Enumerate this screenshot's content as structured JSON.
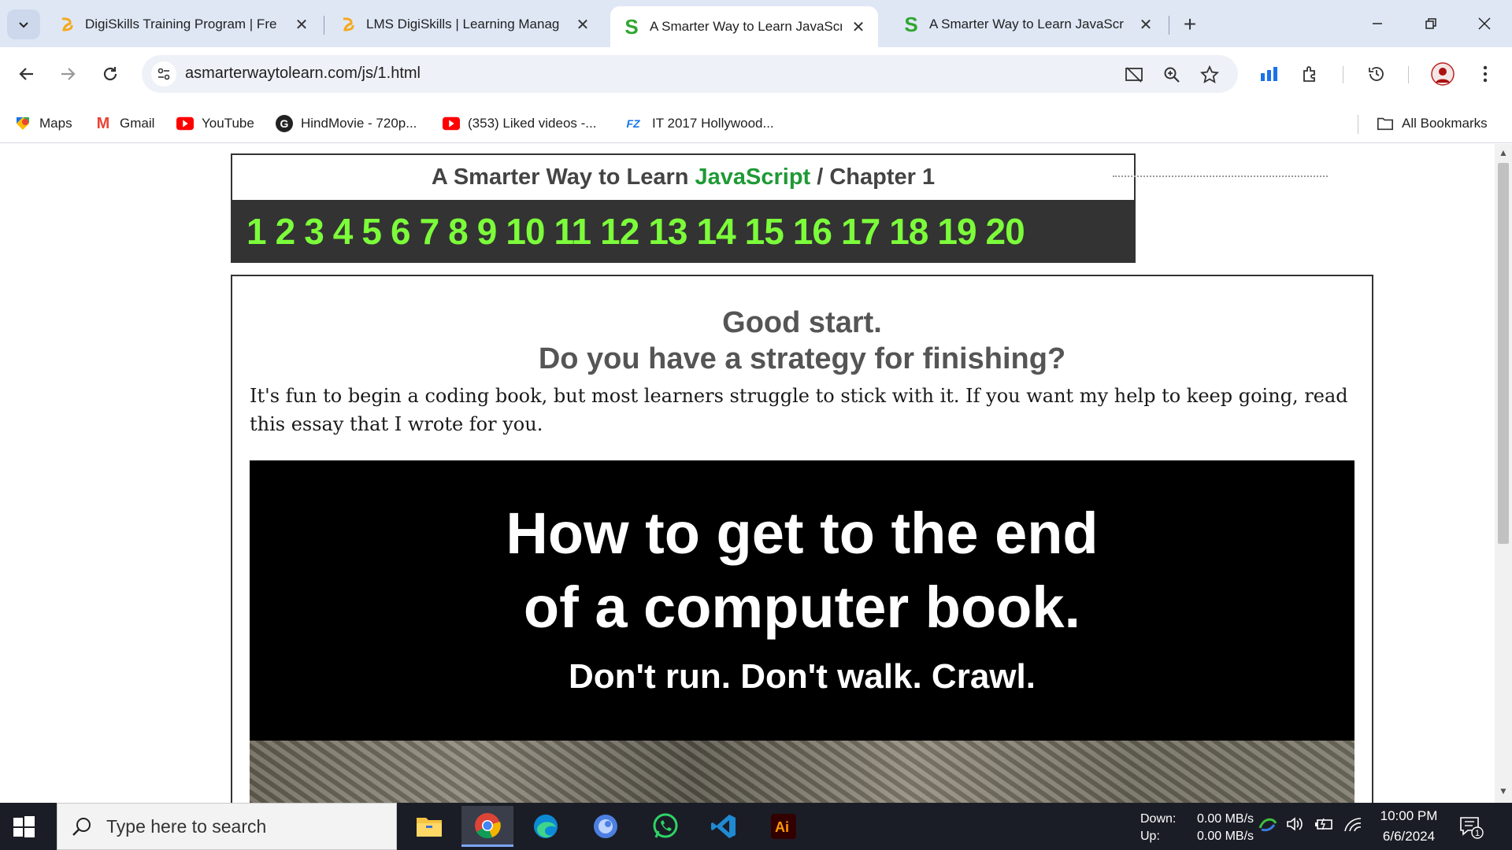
{
  "browser": {
    "tabs": [
      {
        "label": "DigiSkills Training Program | Fre",
        "favicon": "digiskills-icon",
        "active": false
      },
      {
        "label": "LMS DigiSkills | Learning Manag",
        "favicon": "digiskills-icon",
        "active": false
      },
      {
        "label": "A Smarter Way to Learn JavaScr",
        "favicon": "S",
        "active": true
      },
      {
        "label": "A Smarter Way to Learn JavaScr",
        "favicon": "S",
        "active": false
      }
    ],
    "new_tab": "+",
    "url": "asmarterwaytolearn.com/js/1.html",
    "bookmarks": [
      {
        "label": "Maps",
        "icon": "maps-icon"
      },
      {
        "label": "Gmail",
        "icon": "M"
      },
      {
        "label": "YouTube",
        "icon": "youtube-icon"
      },
      {
        "label": "HindMovie - 720p...",
        "icon": "G"
      },
      {
        "label": "(353) Liked videos -...",
        "icon": "youtube-icon"
      },
      {
        "label": "IT 2017 Hollywood...",
        "icon": "FZ"
      }
    ],
    "all_bookmarks": "All Bookmarks",
    "accent_color": "#1a73e8"
  },
  "page": {
    "title_prefix": "A Smarter Way to Learn",
    "title_js": "JavaScript",
    "title_suffix": "/  Chapter 1",
    "chapters": [
      "1",
      "2",
      "3",
      "4",
      "5",
      "6",
      "7",
      "8",
      "9",
      "10",
      "11",
      "12",
      "13",
      "14",
      "15",
      "16",
      "17",
      "18",
      "19",
      "20"
    ],
    "heading_line1": "Good start.",
    "heading_line2": "Do you have a strategy for finishing?",
    "intro": "It's fun to begin a coding book, but most learners struggle to stick with it. If you want my help to keep going, read this essay that I wrote for you.",
    "banner_line1": "How to get to the end",
    "banner_line2": "of a computer book.",
    "banner_sub": "Don't run. Don't walk. Crawl.",
    "accent_green": "#1f9a36",
    "chapter_green": "#7cfc3a"
  },
  "taskbar": {
    "search_placeholder": "Type here to search",
    "net_down_label": "Down:",
    "net_up_label": "Up:",
    "net_down_value": "0.00 MB/s",
    "net_up_value": "0.00 MB/s",
    "time": "10:00 PM",
    "date": "6/6/2024",
    "notification_count": "1"
  }
}
